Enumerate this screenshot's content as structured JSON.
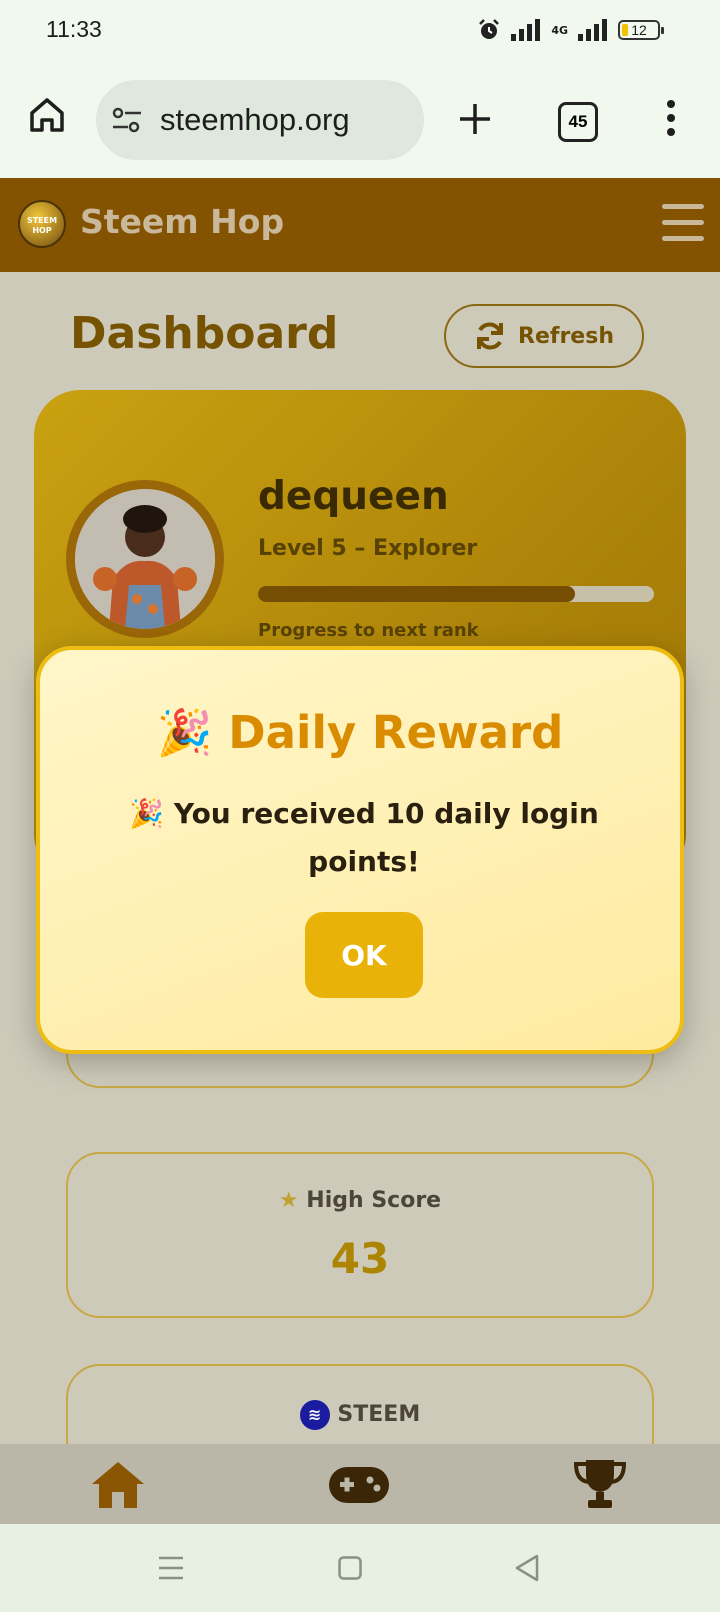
{
  "status_bar": {
    "time": "11:33",
    "network": "4G",
    "battery": "12"
  },
  "browser": {
    "url": "steemhop.org",
    "tab_count": "45"
  },
  "app": {
    "title": "Steem Hop",
    "logo_text": "STEEM HOP"
  },
  "dashboard": {
    "title": "Dashboard",
    "refresh_label": "Refresh",
    "profile": {
      "username": "dequeen",
      "level": "Level 5 – Explorer",
      "progress_fraction": 0.8,
      "progress_label": "Progress to next rank"
    },
    "stats": [
      {
        "label": "High Score",
        "value": "43",
        "icon": "star-icon"
      },
      {
        "label": "STEEM",
        "value": "",
        "icon": "steem-logo-icon"
      }
    ]
  },
  "modal": {
    "title": "Daily Reward",
    "title_icon": "🎉",
    "message": "You received 10 daily login points!",
    "message_icon": "🎉",
    "ok_label": "OK"
  },
  "bottom_nav": {
    "items": [
      "home-icon",
      "gamepad-icon",
      "trophy-icon"
    ]
  },
  "colors": {
    "header": "#845302",
    "accent": "#e9b208",
    "modal_title": "#d98c00"
  }
}
